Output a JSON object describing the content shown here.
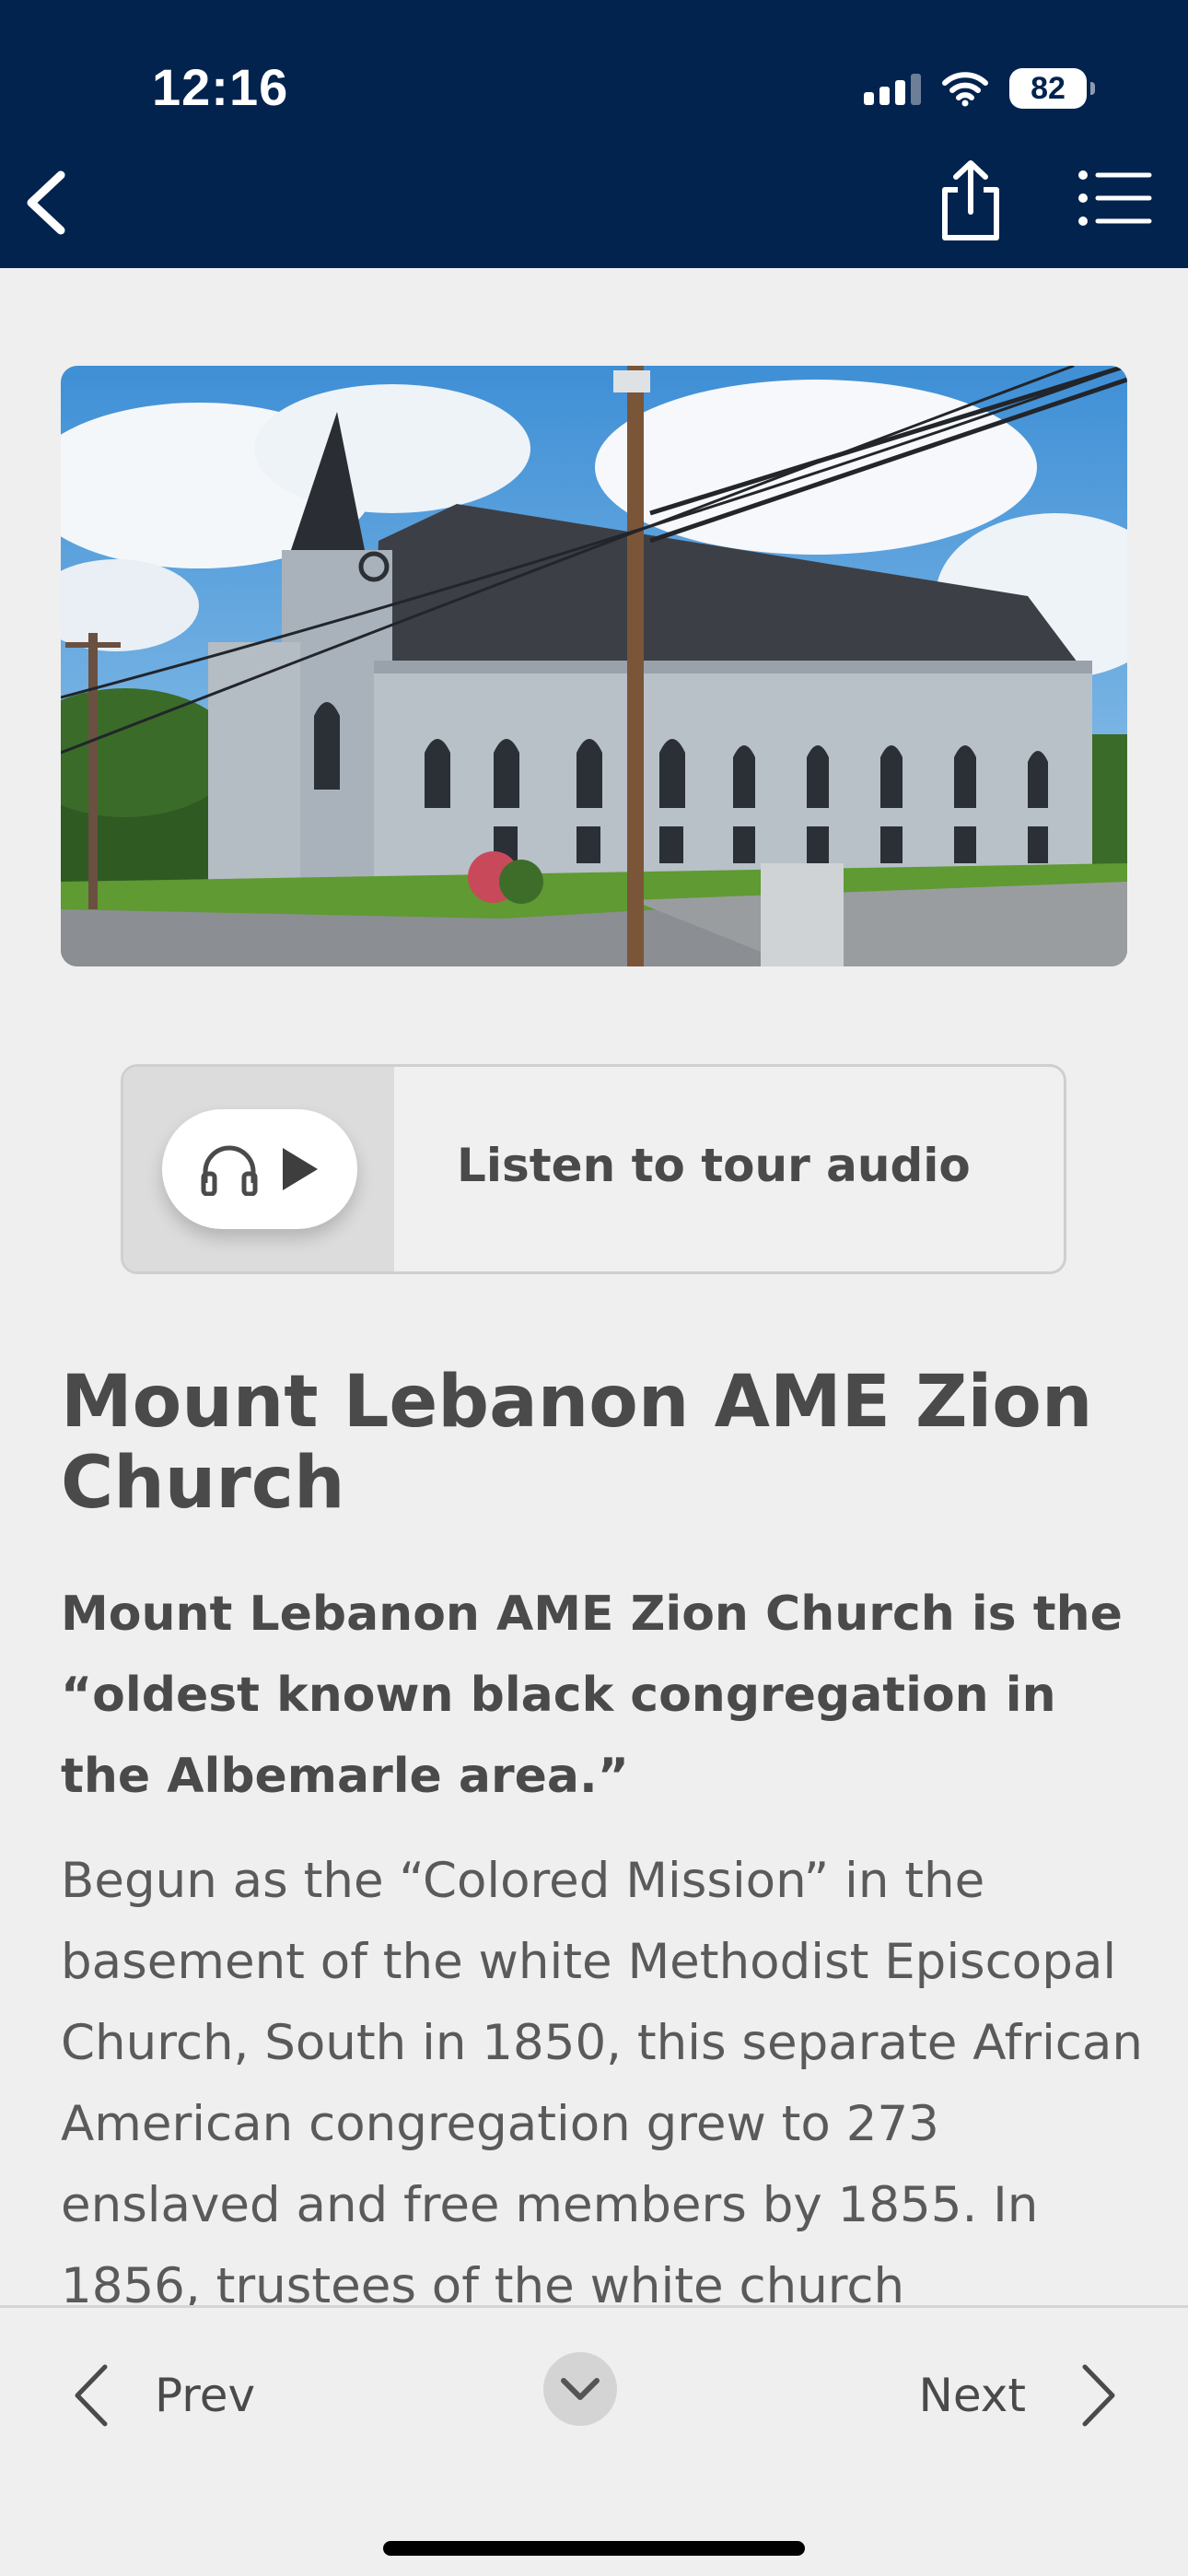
{
  "status": {
    "time": "12:16",
    "battery": "82"
  },
  "colors": {
    "header_bg": "#03234f",
    "page_bg": "#efefef",
    "text": "#4a4a4a"
  },
  "toolbar": {
    "back_icon": "chevron-left-icon",
    "share_icon": "share-icon",
    "menu_icon": "list-icon"
  },
  "hero": {
    "alt": "Mount Lebanon AME Zion Church building"
  },
  "audio": {
    "label": "Listen to tour audio",
    "icons": [
      "headphones-icon",
      "play-icon"
    ]
  },
  "article": {
    "title": "Mount Lebanon AME Zion Church",
    "lead": "Mount Lebanon AME Zion Church is the “oldest known black congregation in the Albemarle area.”",
    "body": "Begun as the “Colored Mission” in the basement of the white Methodist Episcopal Church, South in 1850, this separate African American congregation grew to 273 enslaved and free members by 1855. In 1856, trustees of the white church"
  },
  "footer": {
    "prev": "Prev",
    "next": "Next",
    "collapse_icon": "chevron-down-icon"
  }
}
